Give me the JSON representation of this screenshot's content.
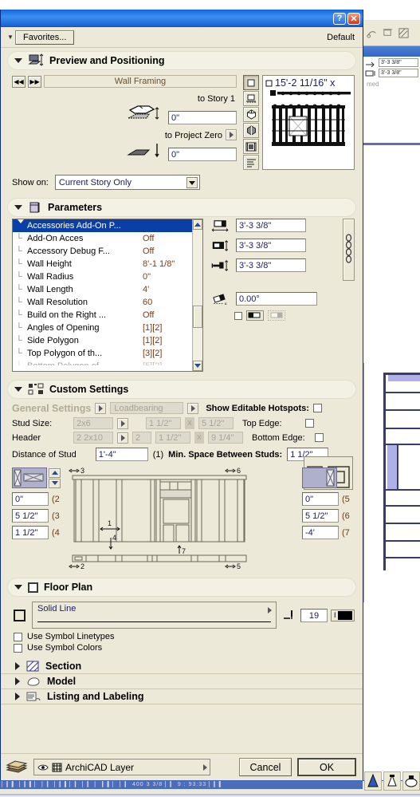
{
  "window": {
    "titlebar_buttons": [
      {
        "name": "help-button",
        "label": "?"
      },
      {
        "name": "close-button",
        "label": "✕"
      }
    ],
    "favorites_button": "Favorites...",
    "default_label": "Default"
  },
  "background": {
    "field1": "3'-3 3/8\"",
    "field2": "3'-3 3/8\"",
    "faded_text": "med"
  },
  "preview_positioning": {
    "title": "Preview and Positioning",
    "nav_prev": "◀◀",
    "nav_next": "▶▶",
    "object_name": "Wall Framing",
    "to_story_label": "to Story 1",
    "to_story_value": "0\"",
    "to_project_zero_label": "to Project Zero",
    "to_project_zero_value": "0\"",
    "show_on_label": "Show on:",
    "show_on_value": "Current Story Only",
    "view_buttons": [
      "plan-view-icon",
      "elevation-view-icon",
      "axonometric-wire-icon",
      "axonometric-solid-icon",
      "3d-window-icon",
      "list-view-icon"
    ],
    "preview_dimension": "15'-2 11/16\" x"
  },
  "parameters": {
    "title": "Parameters",
    "rows": [
      {
        "name": "Accessories Add-On P...",
        "value": "",
        "selected": true,
        "group": true
      },
      {
        "name": "Add-On Acces",
        "value": "Off"
      },
      {
        "name": "Accessory Debug F...",
        "value": "Off"
      },
      {
        "name": "Wall Height",
        "value": "8'-1 1/8\""
      },
      {
        "name": "Wall Radius",
        "value": "0\""
      },
      {
        "name": "Wall Length",
        "value": "4'"
      },
      {
        "name": "Wall Resolution",
        "value": "60"
      },
      {
        "name": "Build on the Right ...",
        "value": "Off"
      },
      {
        "name": "Angles of Opening",
        "value": "[1][2]"
      },
      {
        "name": "Side Polygon",
        "value": "[1][2]"
      },
      {
        "name": "Top Polygon of th...",
        "value": "[3][2]"
      }
    ],
    "size_fields": [
      {
        "icon": "width-icon",
        "value": "3'-3 3/8\""
      },
      {
        "icon": "depth-icon",
        "value": "3'-3 3/8\""
      },
      {
        "icon": "height-icon",
        "value": "3'-3 3/8\""
      }
    ],
    "angle_value": "0.00°",
    "link_icon": "chain-link-icon",
    "mirror_checkbox": false
  },
  "custom_settings": {
    "title": "Custom Settings",
    "general_settings_label": "General Settings",
    "loadbearing_label": "Loadbearing",
    "show_hotspots_label": "Show Editable Hotspots:",
    "show_hotspots_checked": false,
    "stud_size_label": "Stud Size:",
    "stud_size_value": "2x6",
    "stud_w": "1 1/2\"",
    "stud_x": "x",
    "stud_h": "5 1/2\"",
    "header_label": "Header",
    "header_value": "2 2x10",
    "header_count": "2",
    "header_w": "1 1/2\"",
    "header_x": "x",
    "header_h": "9 1/4\"",
    "top_edge_label": "Top Edge:",
    "top_edge_checked": false,
    "bottom_edge_label": "Bottom Edge:",
    "bottom_edge_checked": false,
    "distance_of_stud_label": "Distance of Stud",
    "distance_of_stud_value": "1'-4\"",
    "distance_tag": "(1)",
    "min_space_label": "Min. Space Between Studs:",
    "min_space_value": "1 1/2\"",
    "left_fields": [
      {
        "value": "0\"",
        "tag": "(2"
      },
      {
        "value": "5 1/2\"",
        "tag": "(3"
      },
      {
        "value": "1 1/2\"",
        "tag": "(4"
      }
    ],
    "right_fields": [
      {
        "value": "0\"",
        "tag": "(5"
      },
      {
        "value": "5 1/2\"",
        "tag": "(6"
      },
      {
        "value": "-4'",
        "tag": "(7"
      }
    ],
    "diagram_labels": {
      "top_left": "3",
      "top_right": "6",
      "bottom_left": "2",
      "bottom_right": "5",
      "inner_1": "1",
      "inner_4": "4",
      "inner_7": "7"
    }
  },
  "floor_plan": {
    "title": "Floor Plan",
    "header_checked": false,
    "symbol_checkbox_checked": false,
    "linetype_value": "Solid Line",
    "pen_value": "19",
    "pen_icon": "pen-icon",
    "swatch_label": "I",
    "use_symbol_linetypes": "Use Symbol Linetypes",
    "use_symbol_linetypes_checked": false,
    "use_symbol_colors": "Use Symbol Colors",
    "use_symbol_colors_checked": false
  },
  "collapsed_sections": [
    {
      "title": "Section",
      "icon": "hatch-icon"
    },
    {
      "title": "Model",
      "icon": "model-icon"
    },
    {
      "title": "Listing and Labeling",
      "icon": "listing-icon"
    }
  ],
  "footer": {
    "layer_icon": "layers-icon",
    "eye_icon": "eye-icon",
    "layer_label": "ArchiCAD Layer",
    "cancel_label": "Cancel",
    "ok_label": "OK"
  },
  "colors": {
    "dialog_bg": "#ece9d8",
    "titlebar_blue": "#1b6fe4",
    "selection_blue": "#0b3fa8",
    "value_text": "#7b3a1a",
    "field_text": "#1b1b5e"
  }
}
